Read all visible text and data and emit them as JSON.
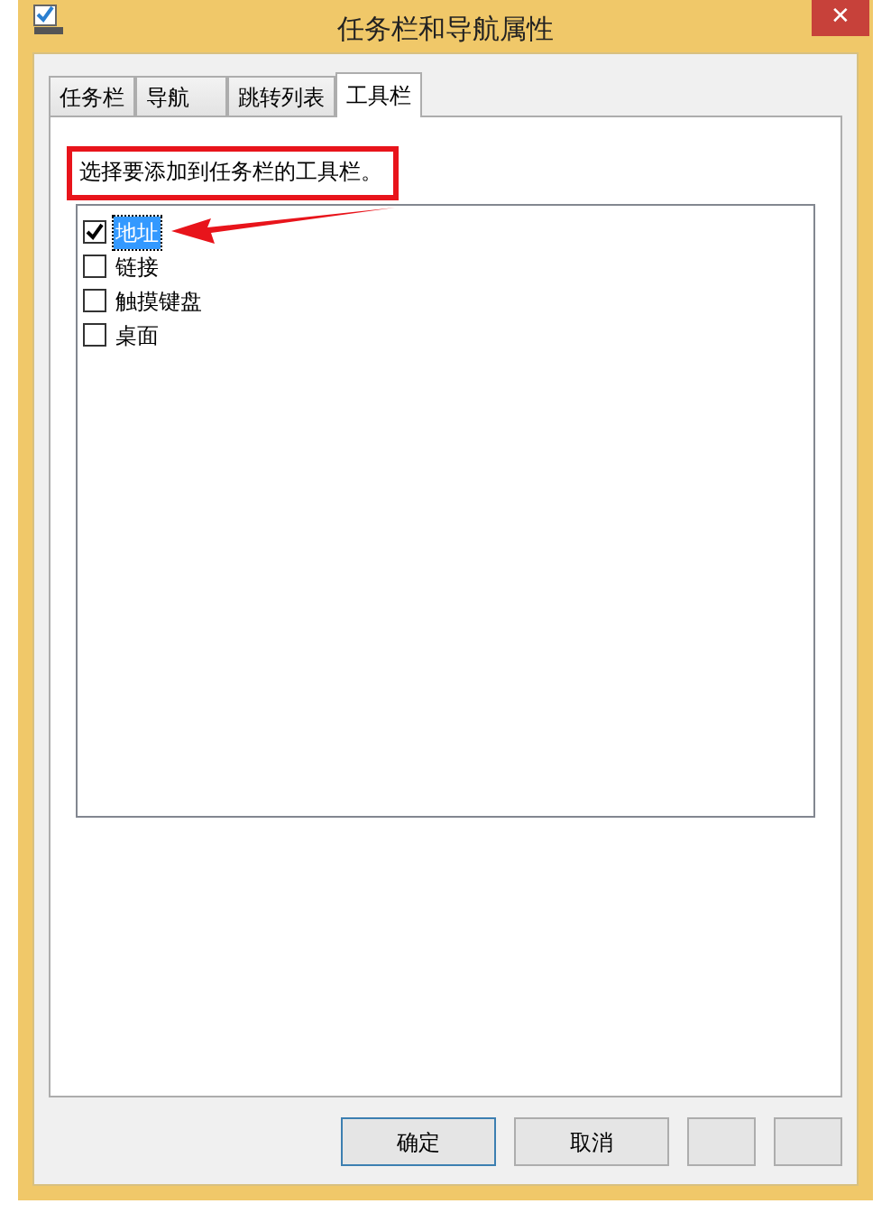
{
  "window": {
    "title": "任务栏和导航属性",
    "close": "✕"
  },
  "tabs": [
    {
      "label": "任务栏",
      "selected": false
    },
    {
      "label": "导航",
      "selected": false
    },
    {
      "label": "跳转列表",
      "selected": false
    },
    {
      "label": "工具栏",
      "selected": true
    }
  ],
  "instruction": "选择要添加到任务栏的工具栏。",
  "toolbars": [
    {
      "label": "地址",
      "checked": true,
      "selected": true
    },
    {
      "label": "链接",
      "checked": false,
      "selected": false
    },
    {
      "label": "触摸键盘",
      "checked": false,
      "selected": false
    },
    {
      "label": "桌面",
      "checked": false,
      "selected": false
    }
  ],
  "buttons": [
    {
      "label": "确定",
      "kind": "default"
    },
    {
      "label": "取消",
      "kind": "normal"
    },
    {
      "kind": "blank"
    },
    {
      "kind": "blank"
    }
  ]
}
